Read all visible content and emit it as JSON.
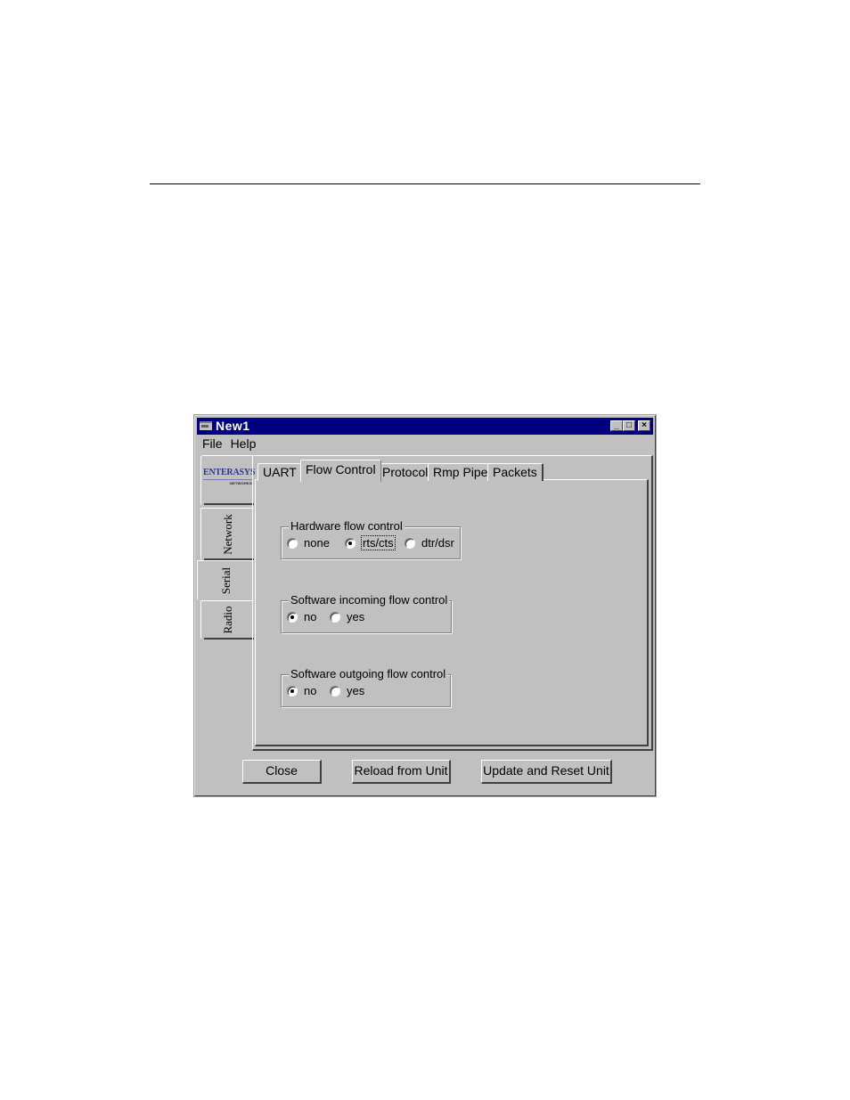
{
  "window": {
    "title": "New1",
    "controls": {
      "minimize": "minimize-icon",
      "maximize": "maximize-icon",
      "close": "close-icon"
    }
  },
  "menu": [
    "File",
    "Help"
  ],
  "logo": {
    "brand": "ENTERASYS",
    "sub": "NETWORKS"
  },
  "side_tabs": [
    {
      "label": "Network",
      "active": false
    },
    {
      "label": "Serial",
      "active": true
    },
    {
      "label": "Radio",
      "active": false
    }
  ],
  "tabs": [
    {
      "label": "UART",
      "active": false
    },
    {
      "label": "Flow Control",
      "active": true
    },
    {
      "label": "Protocol",
      "active": false
    },
    {
      "label": "Rmp Pipe",
      "active": false
    },
    {
      "label": "Packets",
      "active": false
    }
  ],
  "groups": {
    "hardware": {
      "legend": "Hardware flow control",
      "options": [
        "none",
        "rts/cts",
        "dtr/dsr"
      ],
      "selected": "rts/cts"
    },
    "sw_incoming": {
      "legend": "Software incoming flow control",
      "options": [
        "no",
        "yes"
      ],
      "selected": "no"
    },
    "sw_outgoing": {
      "legend": "Software outgoing flow control",
      "options": [
        "no",
        "yes"
      ],
      "selected": "no"
    }
  },
  "buttons": {
    "close": "Close",
    "reload": "Reload from Unit",
    "update": "Update and Reset Unit"
  }
}
